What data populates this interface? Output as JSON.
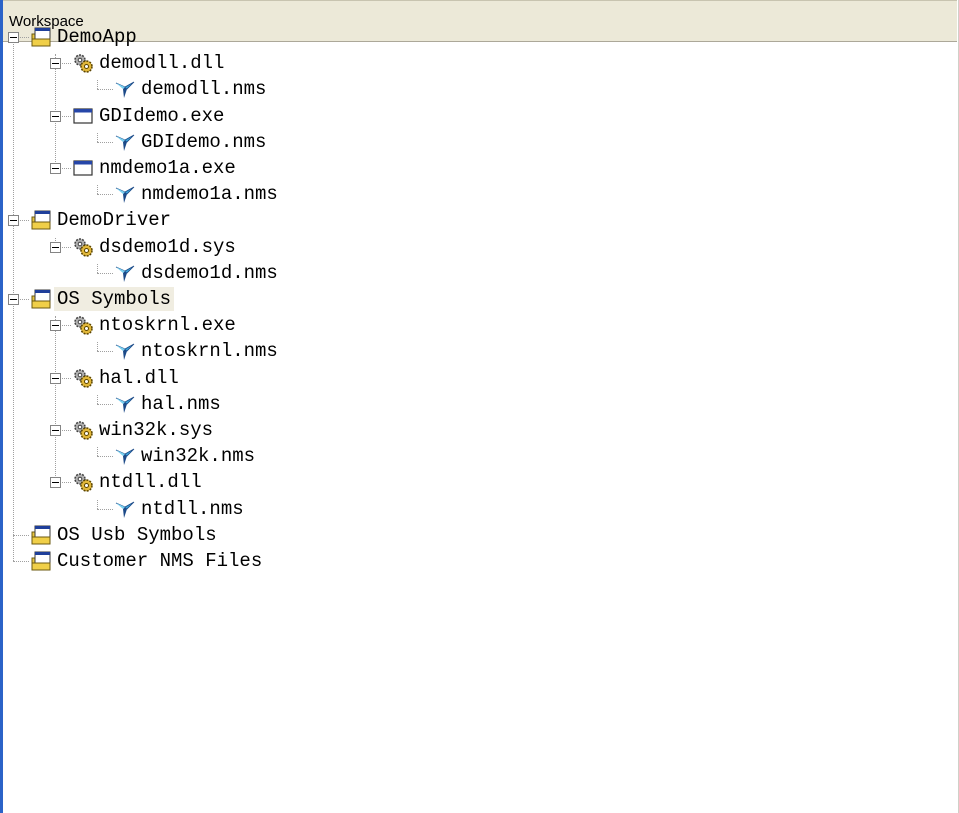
{
  "header": {
    "title": "Workspace"
  },
  "tree": [
    {
      "label": "DemoApp",
      "icon": "project-icon",
      "children": [
        {
          "label": "demodll.dll",
          "icon": "gears-icon",
          "children": [
            {
              "label": "demodll.nms",
              "icon": "symbol-file-icon"
            }
          ]
        },
        {
          "label": "GDIdemo.exe",
          "icon": "window-icon",
          "children": [
            {
              "label": "GDIdemo.nms",
              "icon": "symbol-file-icon"
            }
          ]
        },
        {
          "label": "nmdemo1a.exe",
          "icon": "window-icon",
          "children": [
            {
              "label": "nmdemo1a.nms",
              "icon": "symbol-file-icon"
            }
          ]
        }
      ]
    },
    {
      "label": "DemoDriver",
      "icon": "project-icon",
      "children": [
        {
          "label": "dsdemo1d.sys",
          "icon": "gears-icon",
          "children": [
            {
              "label": "dsdemo1d.nms",
              "icon": "symbol-file-icon"
            }
          ]
        }
      ]
    },
    {
      "label": "OS Symbols",
      "icon": "project-icon",
      "selected": true,
      "children": [
        {
          "label": "ntoskrnl.exe",
          "icon": "gears-icon",
          "children": [
            {
              "label": "ntoskrnl.nms",
              "icon": "symbol-file-icon"
            }
          ]
        },
        {
          "label": "hal.dll",
          "icon": "gears-icon",
          "children": [
            {
              "label": "hal.nms",
              "icon": "symbol-file-icon"
            }
          ]
        },
        {
          "label": "win32k.sys",
          "icon": "gears-icon",
          "children": [
            {
              "label": "win32k.nms",
              "icon": "symbol-file-icon"
            }
          ]
        },
        {
          "label": "ntdll.dll",
          "icon": "gears-icon",
          "children": [
            {
              "label": "ntdll.nms",
              "icon": "symbol-file-icon"
            }
          ]
        }
      ]
    },
    {
      "label": "OS Usb Symbols",
      "icon": "project-icon"
    },
    {
      "label": "Customer NMS Files",
      "icon": "project-icon"
    }
  ],
  "colors": {
    "accent": "#2b63c8",
    "header_bg": "#ece9d8",
    "selected_bg": "#f0ede1"
  }
}
